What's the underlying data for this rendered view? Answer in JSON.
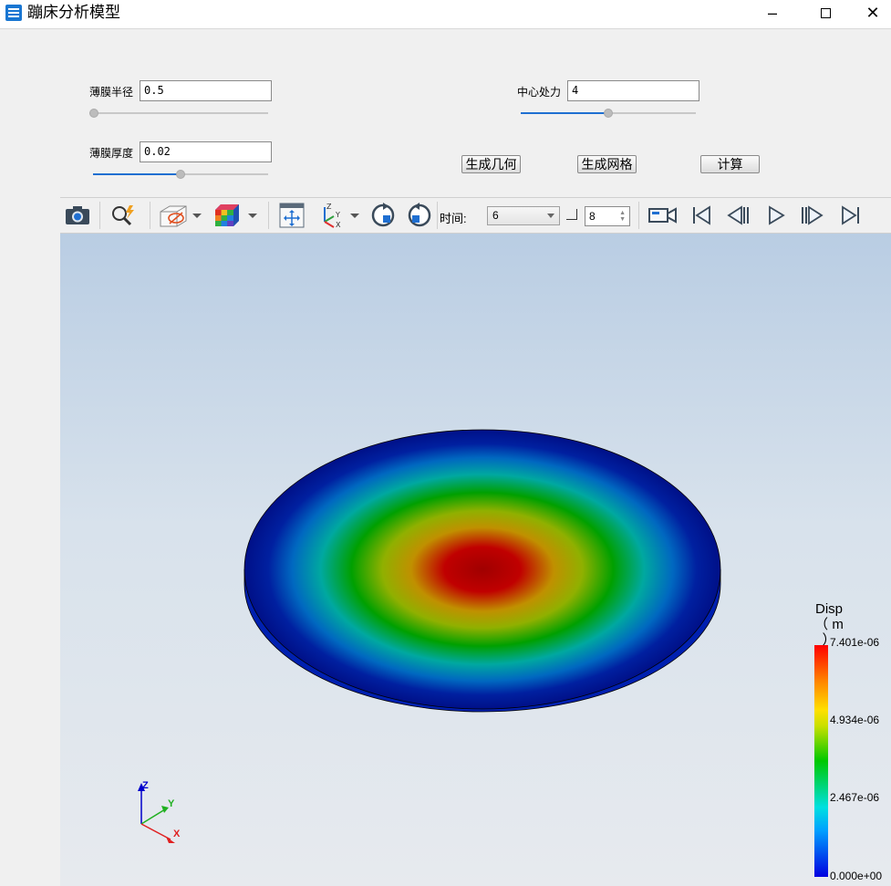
{
  "window": {
    "title": "蹦床分析模型",
    "minimize": "–",
    "close": "✕"
  },
  "params": {
    "radius": {
      "label": "薄膜半径",
      "value": "0.5",
      "slider_value": 0.0
    },
    "thickness": {
      "label": "薄膜厚度",
      "value": "0.02",
      "slider_value": 0.5
    },
    "force": {
      "label": "中心处力",
      "value": "4",
      "slider_value": 0.5
    }
  },
  "buttons": {
    "gen_geometry": "生成几何",
    "gen_mesh": "生成网格",
    "compute": "计算"
  },
  "toolbar": {
    "icons": [
      "camera-icon",
      "zoom-flash-icon",
      "display-mode-icon",
      "color-cube-icon",
      "fit-view-icon",
      "axes-icon",
      "rotate-ccw-icon",
      "rotate-cw-icon",
      "record-video-icon",
      "first-frame-icon",
      "prev-frame-icon",
      "play-icon",
      "next-frame-icon",
      "last-frame-icon"
    ],
    "time_label": "时间:",
    "time_value": "6",
    "frame_value": "8"
  },
  "legend": {
    "title": "Disp",
    "unit": "（ m ）",
    "max": "7.401e-06",
    "v2": "4.934e-06",
    "v1": "2.467e-06",
    "min": "0.000e+00",
    "colors": [
      "#0000e0",
      "#00e0e0",
      "#00c800",
      "#ffe000",
      "#ff0000"
    ]
  },
  "axes": {
    "z": "Z",
    "y": "Y",
    "x": "X"
  }
}
